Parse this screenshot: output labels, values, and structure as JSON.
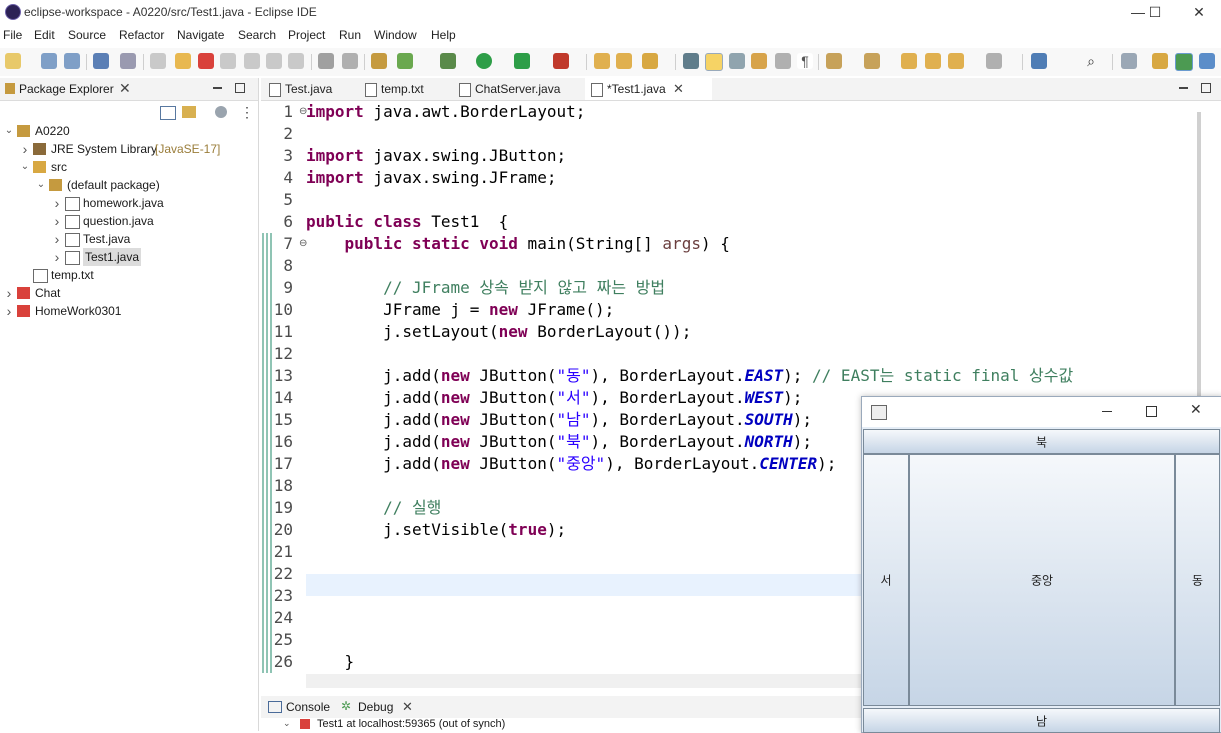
{
  "window": {
    "title": "eclipse-workspace - A0220/src/Test1.java - Eclipse IDE",
    "minimize": "—",
    "maximize": "☐",
    "close": "✕"
  },
  "menu": [
    "File",
    "Edit",
    "Source",
    "Refactor",
    "Navigate",
    "Search",
    "Project",
    "Run",
    "Window",
    "Help"
  ],
  "package_explorer": {
    "title": "Package Explorer",
    "tree": [
      {
        "label": "A0220",
        "extra": "",
        "level": 0,
        "twisty": "open",
        "icon": "project-icon"
      },
      {
        "label": "JRE System Library",
        "extra": "[JavaSE-17]",
        "level": 1,
        "twisty": "closed",
        "icon": "library-icon"
      },
      {
        "label": "src",
        "extra": "",
        "level": 1,
        "twisty": "open",
        "icon": "source-folder-icon"
      },
      {
        "label": "(default package)",
        "extra": "",
        "level": 2,
        "twisty": "open",
        "icon": "package-icon"
      },
      {
        "label": "homework.java",
        "extra": "",
        "level": 3,
        "twisty": "closed",
        "icon": "java-file-icon"
      },
      {
        "label": "question.java",
        "extra": "",
        "level": 3,
        "twisty": "closed",
        "icon": "java-file-icon"
      },
      {
        "label": "Test.java",
        "extra": "",
        "level": 3,
        "twisty": "closed",
        "icon": "java-file-icon"
      },
      {
        "label": "Test1.java",
        "extra": "",
        "level": 3,
        "twisty": "closed",
        "icon": "java-file-icon",
        "selected": true
      },
      {
        "label": "temp.txt",
        "extra": "",
        "level": 1,
        "twisty": "none",
        "icon": "text-file-icon"
      },
      {
        "label": "Chat",
        "extra": "",
        "level": 0,
        "twisty": "closed",
        "icon": "project-error-icon"
      },
      {
        "label": "HomeWork0301",
        "extra": "",
        "level": 0,
        "twisty": "closed",
        "icon": "project-error-icon"
      }
    ]
  },
  "editor": {
    "tabs": [
      {
        "label": "Test.java",
        "active": false
      },
      {
        "label": "temp.txt",
        "active": false
      },
      {
        "label": "ChatServer.java",
        "active": false
      },
      {
        "label": "*Test1.java",
        "active": true
      }
    ],
    "line_numbers": [
      "1",
      "2",
      "3",
      "4",
      "5",
      "6",
      "7",
      "8",
      "9",
      "10",
      "11",
      "12",
      "13",
      "14",
      "15",
      "16",
      "17",
      "18",
      "19",
      "20",
      "21",
      "22",
      "23",
      "24",
      "25",
      "26"
    ],
    "code": {
      "l1_kw": "import",
      "l1_rest": " java.awt.BorderLayout;",
      "l3_kw": "import",
      "l3_rest": " javax.swing.JButton;",
      "l4_kw": "import",
      "l4_rest": " javax.swing.JFrame;",
      "l6_kw": "public class",
      "l6_rest": " Test1  {",
      "l7_kw": "public static void",
      "l7_rest": " main(String[] ",
      "l7_param": "args",
      "l7_end": ") {",
      "l9_comment": "// JFrame 상속 받지 않고 짜는 방법",
      "l10_a": "JFrame j = ",
      "l10_kw": "new",
      "l10_b": " JFrame();",
      "l11_a": "j.setLayout(",
      "l11_kw": "new",
      "l11_b": " BorderLayout());",
      "l13_a": "j.add(",
      "l13_kw": "new",
      "l13_b": " JButton(",
      "l13_str": "\"동\"",
      "l13_c": "), BorderLayout.",
      "l13_const": "EAST",
      "l13_d": "); ",
      "l13_comment": "// EAST는 static final 상수값",
      "l14_a": "j.add(",
      "l14_kw": "new",
      "l14_b": " JButton(",
      "l14_str": "\"서\"",
      "l14_c": "), BorderLayout.",
      "l14_const": "WEST",
      "l14_d": ");",
      "l15_a": "j.add(",
      "l15_kw": "new",
      "l15_b": " JButton(",
      "l15_str": "\"남\"",
      "l15_c": "), BorderLayout.",
      "l15_const": "SOUTH",
      "l15_d": ");",
      "l16_a": "j.add(",
      "l16_kw": "new",
      "l16_b": " JButton(",
      "l16_str": "\"북\"",
      "l16_c": "), BorderLayout.",
      "l16_const": "NORTH",
      "l16_d": ");",
      "l17_a": "j.add(",
      "l17_kw": "new",
      "l17_b": " JButton(",
      "l17_str": "\"중앙\"",
      "l17_c": "), BorderLayout.",
      "l17_const": "CENTER",
      "l17_d": ");",
      "l19_comment": "// 실행",
      "l20_a": "j.setVisible(",
      "l20_kw": "true",
      "l20_b": ");",
      "l26": "}"
    }
  },
  "bottom_panel": {
    "tabs": [
      "Console",
      "Debug"
    ],
    "debug_entry": "Test1 at localhost:59365 (out of synch)"
  },
  "swing_window": {
    "north": "북",
    "west": "서",
    "center": "중앙",
    "east": "동",
    "south": "남"
  }
}
